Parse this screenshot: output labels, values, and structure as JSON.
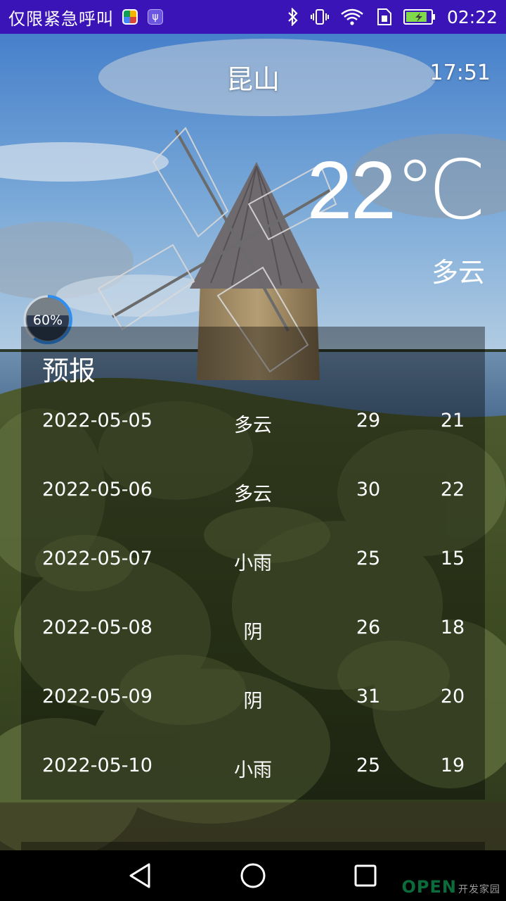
{
  "status_bar": {
    "carrier": "仅限紧急呼叫",
    "time": "02:22",
    "icons": [
      "photos-app-icon",
      "usb-icon",
      "bluetooth-icon",
      "vibrate-icon",
      "wifi-icon",
      "sim-card-icon",
      "battery-charging-icon"
    ],
    "battery_level": 0.85
  },
  "weather": {
    "city": "昆山",
    "update_time": "17:51",
    "temperature": "22℃",
    "condition": "多云"
  },
  "progress": {
    "label": "60%",
    "value": 0.6
  },
  "forecast": {
    "title": "预报",
    "rows": [
      {
        "date": "2022-05-05",
        "condition": "多云",
        "high": "29",
        "low": "21"
      },
      {
        "date": "2022-05-06",
        "condition": "多云",
        "high": "30",
        "low": "22"
      },
      {
        "date": "2022-05-07",
        "condition": "小雨",
        "high": "25",
        "low": "15"
      },
      {
        "date": "2022-05-08",
        "condition": "阴",
        "high": "26",
        "low": "18"
      },
      {
        "date": "2022-05-09",
        "condition": "阴",
        "high": "31",
        "low": "20"
      },
      {
        "date": "2022-05-10",
        "condition": "小雨",
        "high": "25",
        "low": "19"
      }
    ]
  },
  "nav_bar": {
    "buttons": [
      "back-icon",
      "home-icon",
      "recents-icon"
    ]
  },
  "watermark": {
    "text": "OPEN",
    "subtext": "开发家园"
  },
  "colors": {
    "status_bar": "#3b14b8",
    "panel": "rgba(0,0,0,0.38)",
    "ring_accent": "#2f8ef0",
    "text": "#ffffff"
  }
}
